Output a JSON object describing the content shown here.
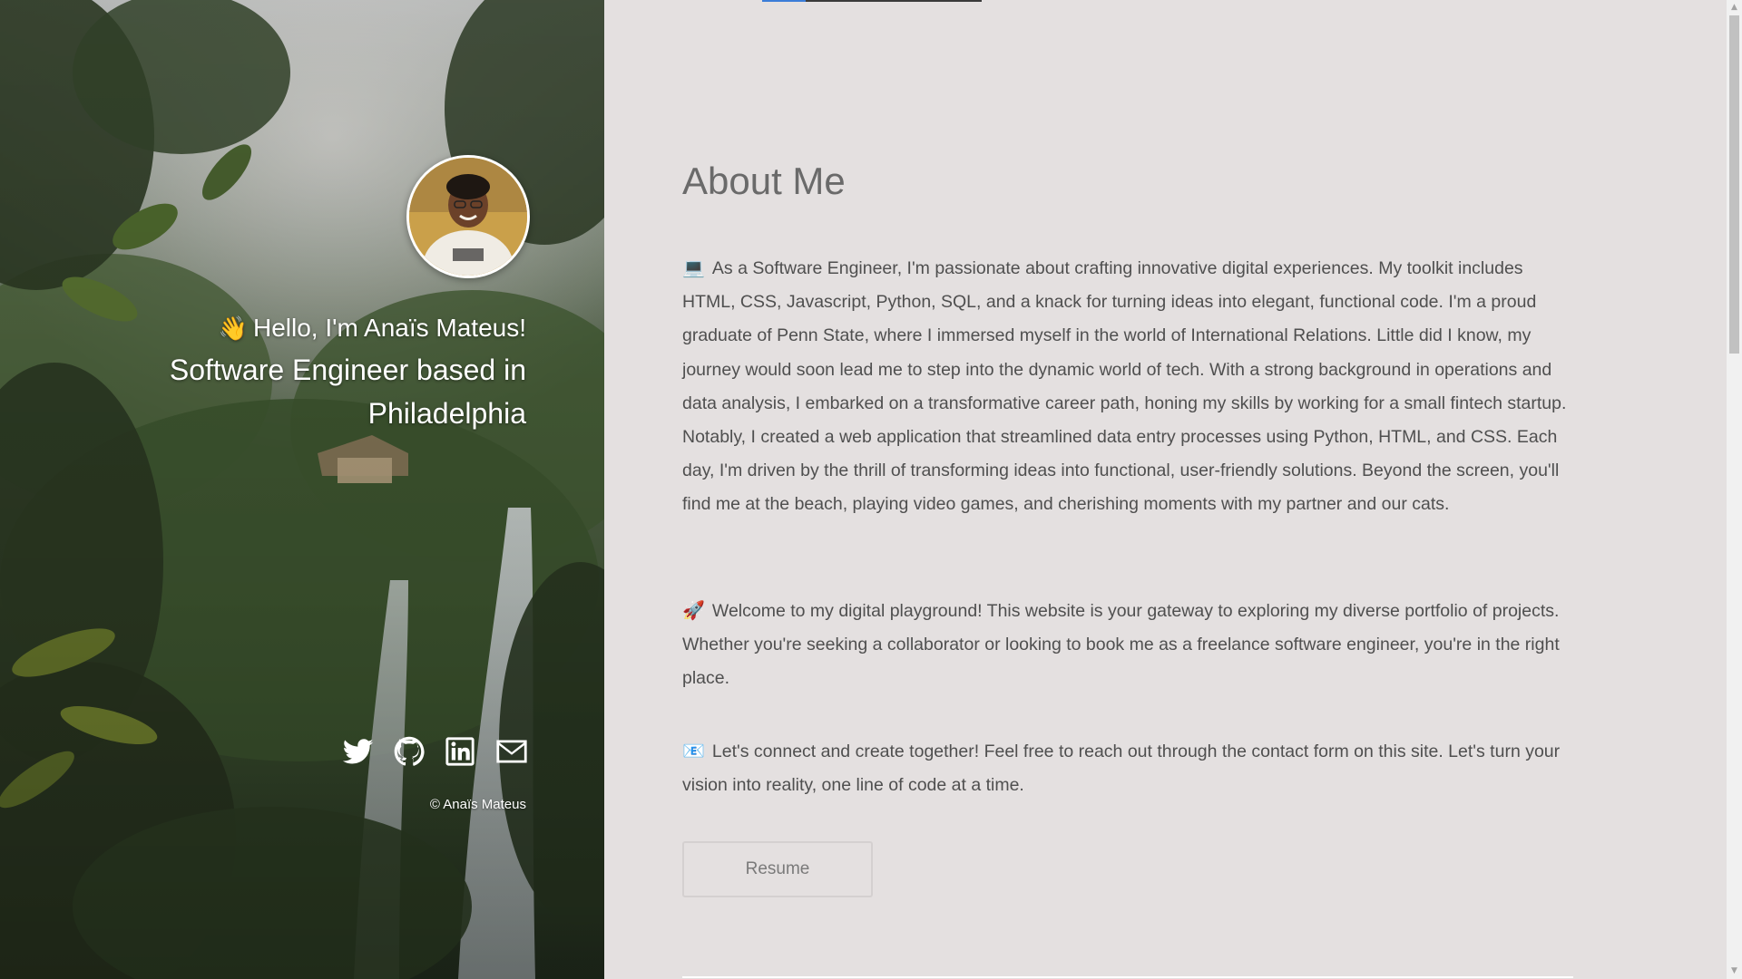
{
  "hero": {
    "greeting_emoji": "👋",
    "greeting": "Hello, I'm Anaïs Mateus!",
    "tagline": "Software Engineer based in Philadelphia",
    "socials": [
      {
        "name": "twitter-icon"
      },
      {
        "name": "github-icon"
      },
      {
        "name": "linkedin-icon"
      },
      {
        "name": "envelope-icon"
      }
    ],
    "copyright": "© Anaïs Mateus"
  },
  "about": {
    "title": "About Me",
    "p1_emoji": "💻",
    "p1": "As a Software Engineer, I'm passionate about crafting innovative digital experiences. My toolkit includes HTML, CSS, Javascript, Python, SQL, and a knack for turning ideas into elegant, functional code. I'm a proud graduate of Penn State, where I immersed myself in the world of International Relations. Little did I know, my journey would soon lead me to step into the dynamic world of tech. With a strong background in operations and data analysis, I embarked on a transformative career path, honing my skills by working for a small fintech startup. Notably, I created a web application that streamlined data entry processes using Python, HTML, and CSS. Each day, I'm driven by the thrill of transforming ideas into functional, user-friendly solutions. Beyond the screen, you'll find me at the beach, playing video games, and cherishing moments with my partner and our cats.",
    "p2_emoji": "🚀",
    "p2": "Welcome to my digital playground! This website is your gateway to exploring my diverse portfolio of projects. Whether you're seeking a collaborator or looking to book me as a freelance software engineer, you're in the right place.",
    "p3_emoji": "📧",
    "p3": "Let's connect and create together! Feel free to reach out through the contact form on this site. Let's turn your vision into reality, one line of code at a time.",
    "resume_label": "Resume"
  },
  "colors": {
    "content_bg": "#e4e0e0",
    "heading": "#6a6a6a",
    "body_text": "#4f4f4f",
    "accent": "#3b7dd8"
  }
}
